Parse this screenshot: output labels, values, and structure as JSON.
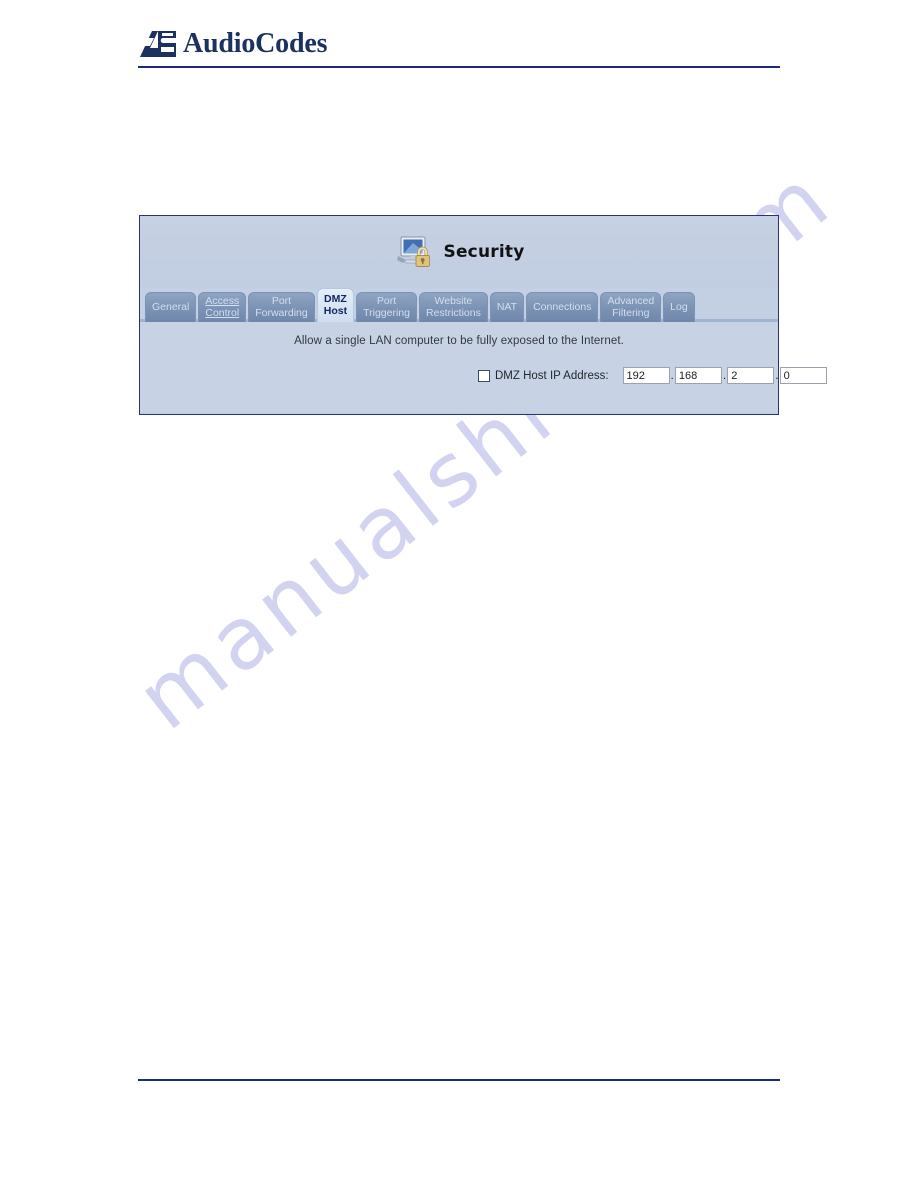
{
  "brand": {
    "name": "AudioCodes",
    "logo_icon": "audiocodes-logo-mark"
  },
  "panel": {
    "title": "Security",
    "title_icon": "monitor-padlock-icon",
    "description": "Allow a single LAN computer to be fully exposed to the Internet.",
    "tabs": [
      {
        "lines": [
          "General"
        ],
        "state": "normal"
      },
      {
        "lines": [
          "Access",
          "Control"
        ],
        "state": "link"
      },
      {
        "lines": [
          "Port",
          "Forwarding"
        ],
        "state": "normal"
      },
      {
        "lines": [
          "DMZ",
          "Host"
        ],
        "state": "active"
      },
      {
        "lines": [
          "Port",
          "Triggering"
        ],
        "state": "normal"
      },
      {
        "lines": [
          "Website",
          "Restrictions"
        ],
        "state": "normal"
      },
      {
        "lines": [
          "NAT"
        ],
        "state": "normal"
      },
      {
        "lines": [
          "Connections"
        ],
        "state": "normal"
      },
      {
        "lines": [
          "Advanced",
          "Filtering"
        ],
        "state": "normal"
      },
      {
        "lines": [
          "Log"
        ],
        "state": "normal"
      }
    ],
    "form": {
      "checkbox_checked": false,
      "label": "DMZ Host IP Address:",
      "separator": ".",
      "ip_octets": [
        "192",
        "168",
        "2",
        "0"
      ]
    }
  },
  "watermark": {
    "text": "manualshive.com",
    "color": "#c9c9ee"
  },
  "colors": {
    "brand_navy": "#1b3260",
    "rule": "#1b2a7a",
    "panel_bg": "#c7d2e4",
    "panel_border": "#2b2f7c",
    "tab_active_text": "#10265e"
  }
}
